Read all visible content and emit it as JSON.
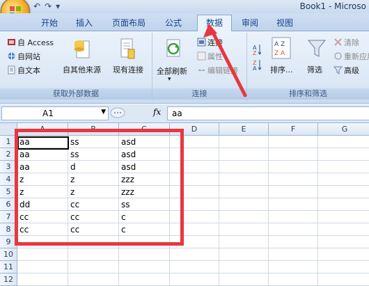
{
  "window": {
    "title": "Book1 - Microso"
  },
  "qat": {
    "undo": "↶",
    "redo": "↷",
    "more": "▾"
  },
  "tabs": [
    {
      "label": "开始"
    },
    {
      "label": "插入"
    },
    {
      "label": "页面布局"
    },
    {
      "label": "公式"
    },
    {
      "label": "数据",
      "active": true
    },
    {
      "label": "审阅"
    },
    {
      "label": "视图"
    }
  ],
  "ribbon": {
    "external": {
      "label": "获取外部数据",
      "access": "自 Access",
      "web": "自网站",
      "text": "自文本",
      "other": "自其他来源",
      "existing": "现有连接"
    },
    "connections": {
      "label": "连接",
      "refresh_all": "全部刷新",
      "connect": "连接",
      "properties": "属性",
      "edit_links": "编辑链接"
    },
    "sort_filter": {
      "label": "排序和筛选",
      "sort": "排序...",
      "filter": "筛选",
      "clear": "清除",
      "reapply": "重新应用",
      "advanced": "高级"
    }
  },
  "formula_bar": {
    "name_box": "A1",
    "fx": "fx",
    "value": "aa"
  },
  "sheet": {
    "columns": [
      "A",
      "B",
      "C",
      "D",
      "E",
      "F",
      "G"
    ],
    "rows": [
      "1",
      "2",
      "3",
      "4",
      "5",
      "6",
      "7",
      "8",
      "9",
      "10",
      "11",
      "12"
    ],
    "cells": [
      [
        "aa",
        "ss",
        "asd"
      ],
      [
        "aa",
        "ss",
        "asd"
      ],
      [
        "aa",
        "d",
        "asd"
      ],
      [
        "z",
        "z",
        "zzz"
      ],
      [
        "z",
        "z",
        "zzz"
      ],
      [
        "dd",
        "cc",
        "ss"
      ],
      [
        "cc",
        "cc",
        "c"
      ],
      [
        "cc",
        "cc",
        "c"
      ]
    ]
  },
  "colors": {
    "annotation": "#e8373f",
    "ribbon_text": "#15428b"
  }
}
